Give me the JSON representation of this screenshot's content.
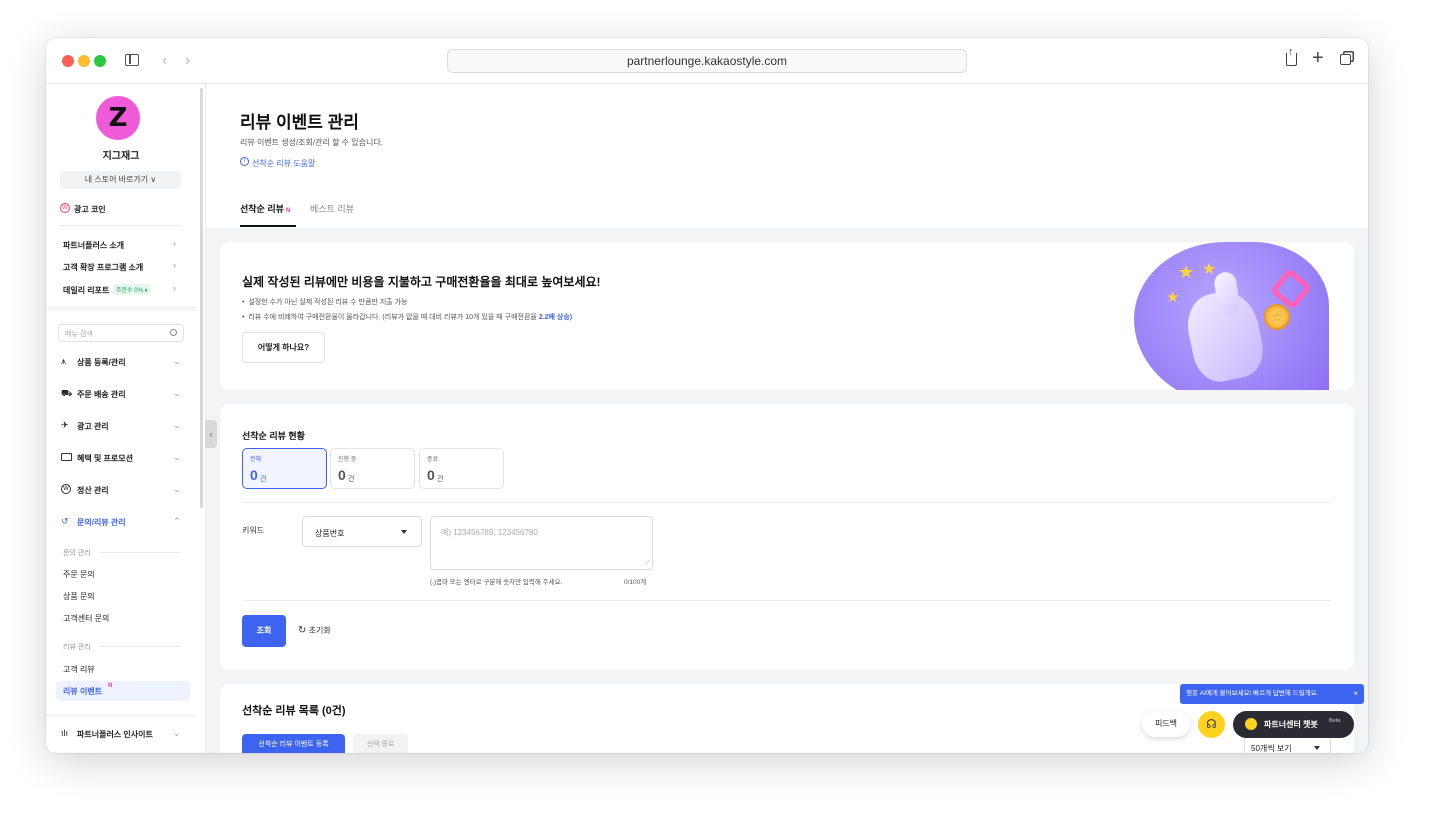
{
  "browser": {
    "url": "partnerlounge.kakaostyle.com"
  },
  "sidebar": {
    "logo_letter": "Z",
    "store_name": "지그재그",
    "store_button": "내 스토어 바로가기 ∨",
    "ad_coin": "광고 코인",
    "links": [
      {
        "label": "파트너플러스 소개"
      },
      {
        "label": "고객 확장 프로그램 소개"
      },
      {
        "label": "데일리 리포트",
        "badge": "주문수 0% ♦"
      }
    ],
    "search_placeholder": "메뉴 검색",
    "menus": [
      {
        "label": "상품 등록/관리"
      },
      {
        "label": "주문 배송 관리"
      },
      {
        "label": "광고 관리"
      },
      {
        "label": "혜택 및 프로모션"
      },
      {
        "label": "정산 관리"
      },
      {
        "label": "문의/리뷰 관리"
      }
    ],
    "inquiry_section": "문의 관리",
    "inquiry_items": [
      "주문 문의",
      "상품 문의",
      "고객센터 문의"
    ],
    "review_section": "리뷰 관리",
    "review_items": [
      "고객 리뷰",
      "리뷰 이벤트"
    ],
    "new_mark": "N",
    "insight": "파트너플러스 인사이트"
  },
  "page": {
    "title": "리뷰 이벤트 관리",
    "subtitle": "리뷰 이벤트 생성/조회/관리 할 수 있습니다.",
    "help_link": "선착순 리뷰 도움말",
    "tabs": [
      {
        "label": "선착순 리뷰",
        "badge": "N"
      },
      {
        "label": "베스트 리뷰"
      }
    ]
  },
  "banner": {
    "title": "실제 작성된 리뷰에만 비용을 지불하고 구매전환율을 최대로 높여보세요!",
    "bullet1": "설정한 수가 아닌 실제 작성된 리뷰 수 만큼만 지출 가능",
    "bullet2": "리뷰 수에 비례하여 구매전환율이 올라갑니다. (리뷰가 없을 때 대비 리뷰가 10개 있을 때 구매전환율",
    "bullet2_highlight": "2.2배 상승)",
    "button": "어떻게 하나요?"
  },
  "status": {
    "title": "선착순 리뷰 현황",
    "cards": [
      {
        "label": "전체",
        "count": "0",
        "unit": "건"
      },
      {
        "label": "진행 중",
        "count": "0",
        "unit": "건"
      },
      {
        "label": "종료",
        "count": "0",
        "unit": "건"
      }
    ],
    "keyword_label": "키워드",
    "select_value": "상품번호",
    "textarea_placeholder": "예) 123456789, 123456780",
    "hint": "(,)콤마 또는 엔터로 구분해 숫자만 입력해 주세요.",
    "counter": "0/100개",
    "search_button": "조회",
    "reset_button": "초기화"
  },
  "list": {
    "title": "선착순 리뷰 목록 (0건)",
    "register_button": "선착순 리뷰 이벤트 등록",
    "end_button": "선택 종료",
    "page_size": "50개씩 보기"
  },
  "floating": {
    "tooltip": "챗봇 AI에게 물어보세요! 빠르게 답변해 드릴게요.",
    "feedback": "피드백",
    "chatbot": "파트너센터 챗봇",
    "beta": "Beta"
  },
  "colors": {
    "accent": "#3c64f0",
    "brand_pink": "#f05ad8",
    "new_pink": "#ff3399",
    "banner_purple": "#9b84f7"
  }
}
